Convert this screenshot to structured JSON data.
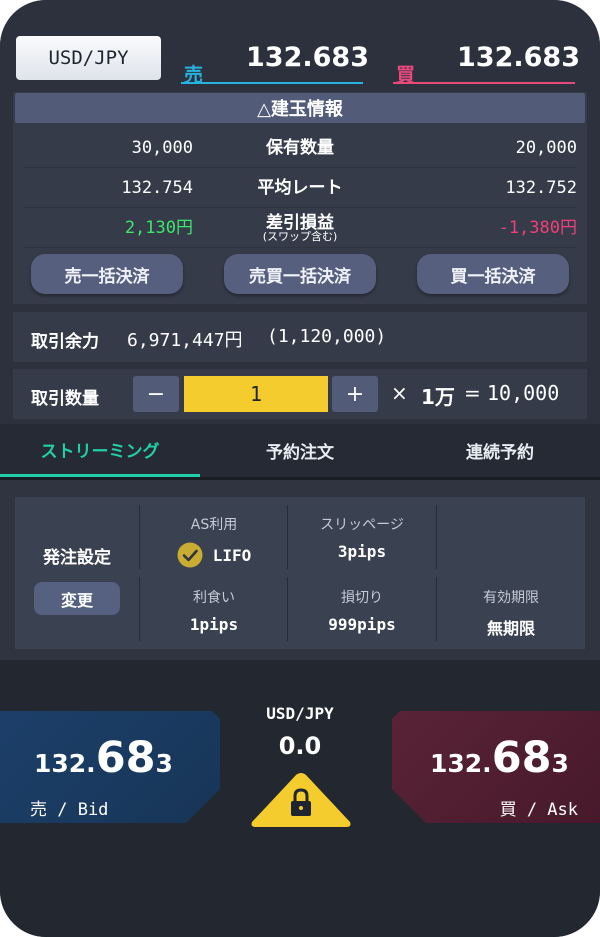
{
  "header": {
    "pair": "USD/JPY",
    "sell_label": "売",
    "sell_price": "132.683",
    "buy_label": "買",
    "buy_price": "132.683",
    "sell_color": "#27b3e0",
    "buy_color": "#e8497b"
  },
  "position": {
    "title": "△建玉情報",
    "rows": [
      {
        "left": "30,000",
        "label": "保有数量",
        "right": "20,000"
      },
      {
        "left": "132.754",
        "label": "平均レート",
        "right": "132.752"
      },
      {
        "left": "2,130円",
        "label": "差引損益",
        "sublabel": "(スワップ含む)",
        "right": "-1,380円"
      }
    ],
    "profit_color": "#3ee66b",
    "loss_color": "#f0407a",
    "buttons": [
      "売一括決済",
      "売買一括決済",
      "買一括決済"
    ]
  },
  "margin": {
    "label": "取引余力",
    "value": "6,971,447円",
    "sub": "(1,120,000)"
  },
  "quantity": {
    "label": "取引数量",
    "minus": "−",
    "value": "1",
    "plus": "+",
    "times": "×",
    "unit": "1万",
    "equals": "=",
    "total": "10,000"
  },
  "tabs": [
    {
      "label": "ストリーミング",
      "active": true
    },
    {
      "label": "予約注文",
      "active": false
    },
    {
      "label": "連続予約",
      "active": false
    }
  ],
  "accent_color": "#21d0a8",
  "order_settings": {
    "label": "発注設定",
    "change_button": "変更",
    "cells": [
      {
        "header": "AS利用",
        "value": "LIFO",
        "icon": "check-icon"
      },
      {
        "header": "スリッページ",
        "value": "3pips"
      },
      {
        "header": "利食い",
        "value": "1pips"
      },
      {
        "header": "損切り",
        "value": "999pips"
      },
      {
        "header": "有効期限",
        "value": "無期限"
      }
    ]
  },
  "trade": {
    "pair": "USD/JPY",
    "spread": "0.0",
    "bid": {
      "prefix": "132.",
      "big": "68",
      "suffix": "3",
      "label": "売 / Bid"
    },
    "ask": {
      "prefix": "132.",
      "big": "68",
      "suffix": "3",
      "label": "買 / Ask"
    },
    "lock_icon": "lock-icon",
    "lock_color": "#f5cc2d"
  }
}
